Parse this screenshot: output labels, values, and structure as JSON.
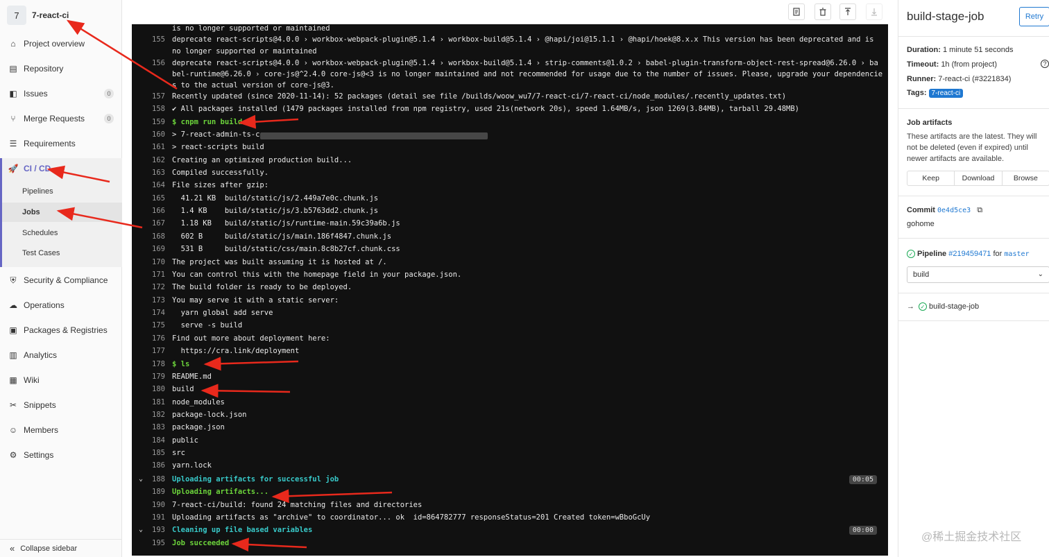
{
  "sidebar": {
    "avatar_letter": "7",
    "project_name": "7-react-ci",
    "items": [
      {
        "label": "Project overview",
        "icon": "home-icon"
      },
      {
        "label": "Repository",
        "icon": "book-icon"
      },
      {
        "label": "Issues",
        "icon": "issues-icon",
        "badge": "0"
      },
      {
        "label": "Merge Requests",
        "icon": "merge-request-icon",
        "badge": "0"
      },
      {
        "label": "Requirements",
        "icon": "requirements-icon"
      },
      {
        "label": "CI / CD",
        "icon": "rocket-icon"
      },
      {
        "label": "Security & Compliance",
        "icon": "shield-icon"
      },
      {
        "label": "Operations",
        "icon": "cloud-icon"
      },
      {
        "label": "Packages & Registries",
        "icon": "package-icon"
      },
      {
        "label": "Analytics",
        "icon": "chart-icon"
      },
      {
        "label": "Wiki",
        "icon": "wiki-icon"
      },
      {
        "label": "Snippets",
        "icon": "scissors-icon"
      },
      {
        "label": "Members",
        "icon": "users-icon"
      },
      {
        "label": "Settings",
        "icon": "gear-icon"
      }
    ],
    "cicd_sub": [
      "Pipelines",
      "Jobs",
      "Schedules",
      "Test Cases"
    ],
    "collapse_label": "Collapse sidebar"
  },
  "toolbar": {
    "icons": [
      "raw-log-icon",
      "erase-icon",
      "scroll-top-icon",
      "scroll-bottom-icon"
    ]
  },
  "log": {
    "lines": [
      {
        "n": "",
        "t": "is no longer supported or maintained",
        "c": ""
      },
      {
        "n": "155",
        "t": "deprecate react-scripts@4.0.0 › workbox-webpack-plugin@5.1.4 › workbox-build@5.1.4 › @hapi/joi@15.1.1 › @hapi/hoek@8.x.x This version has been deprecated and is",
        "c": ""
      },
      {
        "n": "",
        "t": "no longer supported or maintained",
        "c": ""
      },
      {
        "n": "156",
        "t": "deprecate react-scripts@4.0.0 › workbox-webpack-plugin@5.1.4 › workbox-build@5.1.4 › strip-comments@1.0.2 › babel-plugin-transform-object-rest-spread@6.26.0 › ba",
        "c": ""
      },
      {
        "n": "",
        "t": "bel-runtime@6.26.0 › core-js@^2.4.0 core-js@<3 is no longer maintained and not recommended for usage due to the number of issues. Please, upgrade your dependencie",
        "c": ""
      },
      {
        "n": "",
        "t": "s to the actual version of core-js@3.",
        "c": ""
      },
      {
        "n": "157",
        "t": "Recently updated (since 2020-11-14): 52 packages (detail see file /builds/woow_wu7/7-react-ci/7-react-ci/node_modules/.recently_updates.txt)",
        "c": ""
      },
      {
        "n": "158",
        "t": "✔ All packages installed (1479 packages installed from npm registry, used 21s(network 20s), speed 1.64MB/s, json 1269(3.84MB), tarball 29.48MB)",
        "c": ""
      },
      {
        "n": "159",
        "t": "$ cnpm run build",
        "c": "green"
      },
      {
        "n": "160",
        "t": "> 7-react-admin-ts-c",
        "c": ""
      },
      {
        "n": "161",
        "t": "> react-scripts build",
        "c": ""
      },
      {
        "n": "162",
        "t": "Creating an optimized production build...",
        "c": ""
      },
      {
        "n": "163",
        "t": "Compiled successfully.",
        "c": ""
      },
      {
        "n": "164",
        "t": "File sizes after gzip:",
        "c": ""
      },
      {
        "n": "165",
        "t": "  41.21 KB  build/static/js/2.449a7e0c.chunk.js",
        "c": ""
      },
      {
        "n": "166",
        "t": "  1.4 KB    build/static/js/3.b5763dd2.chunk.js",
        "c": ""
      },
      {
        "n": "167",
        "t": "  1.18 KB   build/static/js/runtime-main.59c39a6b.js",
        "c": ""
      },
      {
        "n": "168",
        "t": "  602 B     build/static/js/main.186f4847.chunk.js",
        "c": ""
      },
      {
        "n": "169",
        "t": "  531 B     build/static/css/main.8c8b27cf.chunk.css",
        "c": ""
      },
      {
        "n": "170",
        "t": "The project was built assuming it is hosted at /.",
        "c": ""
      },
      {
        "n": "171",
        "t": "You can control this with the homepage field in your package.json.",
        "c": ""
      },
      {
        "n": "172",
        "t": "The build folder is ready to be deployed.",
        "c": ""
      },
      {
        "n": "173",
        "t": "You may serve it with a static server:",
        "c": ""
      },
      {
        "n": "174",
        "t": "  yarn global add serve",
        "c": ""
      },
      {
        "n": "175",
        "t": "  serve -s build",
        "c": ""
      },
      {
        "n": "176",
        "t": "Find out more about deployment here:",
        "c": ""
      },
      {
        "n": "177",
        "t": "  https://cra.link/deployment",
        "c": ""
      },
      {
        "n": "178",
        "t": "$ ls",
        "c": "green"
      },
      {
        "n": "179",
        "t": "README.md",
        "c": ""
      },
      {
        "n": "180",
        "t": "build",
        "c": ""
      },
      {
        "n": "181",
        "t": "node_modules",
        "c": ""
      },
      {
        "n": "182",
        "t": "package-lock.json",
        "c": ""
      },
      {
        "n": "183",
        "t": "package.json",
        "c": ""
      },
      {
        "n": "184",
        "t": "public",
        "c": ""
      },
      {
        "n": "185",
        "t": "src",
        "c": ""
      },
      {
        "n": "186",
        "t": "yarn.lock",
        "c": ""
      },
      {
        "n": "188",
        "t": "Uploading artifacts for successful job",
        "c": "cyan",
        "section": true,
        "dur": "00:05"
      },
      {
        "n": "189",
        "t": "Uploading artifacts...",
        "c": "green"
      },
      {
        "n": "190",
        "t": "7-react-ci/build: found 24 matching files and directories",
        "c": ""
      },
      {
        "n": "191",
        "t": "Uploading artifacts as \"archive\" to coordinator... ok  id=864782777 responseStatus=201 Created token=wBboGcUy",
        "c": ""
      },
      {
        "n": "193",
        "t": "Cleaning up file based variables",
        "c": "cyan",
        "section": true,
        "dur": "00:00"
      },
      {
        "n": "195",
        "t": "Job succeeded",
        "c": "green"
      }
    ]
  },
  "job": {
    "title": "build-stage-job",
    "retry_label": "Retry",
    "duration_label": "Duration:",
    "duration_value": "1 minute 51 seconds",
    "timeout_label": "Timeout:",
    "timeout_value": "1h (from project)",
    "runner_label": "Runner:",
    "runner_value": "7-react-ci (#3221834)",
    "tags_label": "Tags:",
    "tag": "7-react-ci",
    "help_icon": "question-icon",
    "artifacts_title": "Job artifacts",
    "artifacts_text": "These artifacts are the latest. They will not be deleted (even if expired) until newer artifacts are available.",
    "keep_label": "Keep",
    "download_label": "Download",
    "browse_label": "Browse",
    "commit_label": "Commit",
    "commit_sha": "0e4d5ce3",
    "commit_message": "gohome",
    "pipeline_label": "Pipeline",
    "pipeline_id": "#219459471",
    "pipeline_for": "for",
    "branch": "master",
    "stage_select": "build",
    "job_link": "build-stage-job"
  },
  "watermark": "@稀土掘金技术社区",
  "colors": {
    "accent": "#1f78d1",
    "success": "#1aaa55",
    "log_green": "#6cd43b",
    "annotation_red": "#e8291c"
  }
}
